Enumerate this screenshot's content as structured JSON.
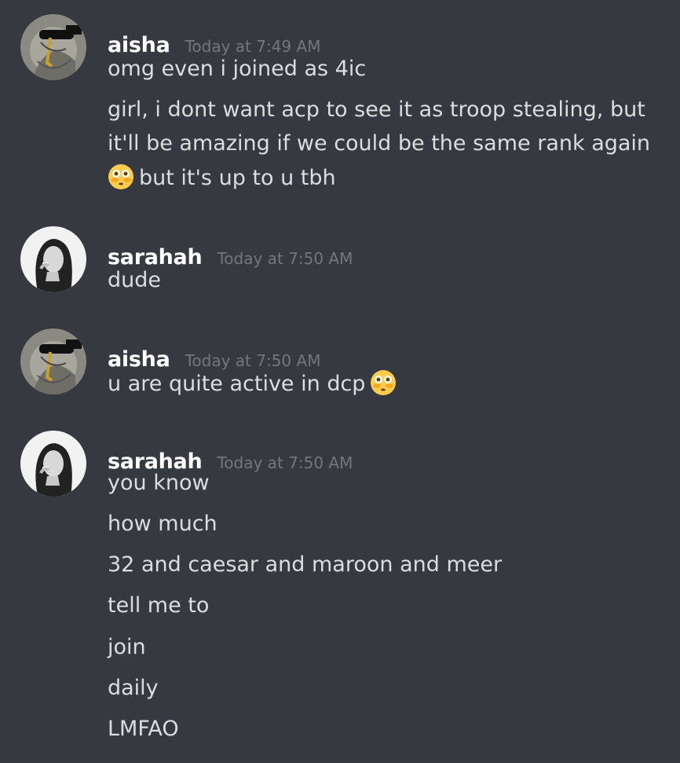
{
  "messages": [
    {
      "username": "aisha",
      "timestamp": "Today at 7:49 AM",
      "avatar_icon": "aisha-avatar",
      "lines": [
        "omg even i joined as 4ic",
        "girl, i dont want acp to see it as troop stealing, but",
        "it'll be amazing if we could be the same rank again",
        "but it's up to u tbh"
      ]
    },
    {
      "username": "sarahah",
      "timestamp": "Today at 7:50 AM",
      "avatar_icon": "sarahah-avatar",
      "lines": [
        "dude"
      ]
    },
    {
      "username": "aisha",
      "timestamp": "Today at 7:50 AM",
      "avatar_icon": "aisha-avatar",
      "lines": [
        "u are quite active in dcp"
      ]
    },
    {
      "username": "sarahah",
      "timestamp": "Today at 7:50 AM",
      "avatar_icon": "sarahah-avatar",
      "lines": [
        "you know",
        "how much",
        "32 and caesar and maroon and meer",
        "tell me to",
        "join",
        "daily",
        "LMFAO"
      ]
    }
  ],
  "emoji": "flushed-face-emoji",
  "colors": {
    "background": "#36393f",
    "username": "#ffffff",
    "timestamp": "#72767d",
    "text": "#dcddde"
  }
}
